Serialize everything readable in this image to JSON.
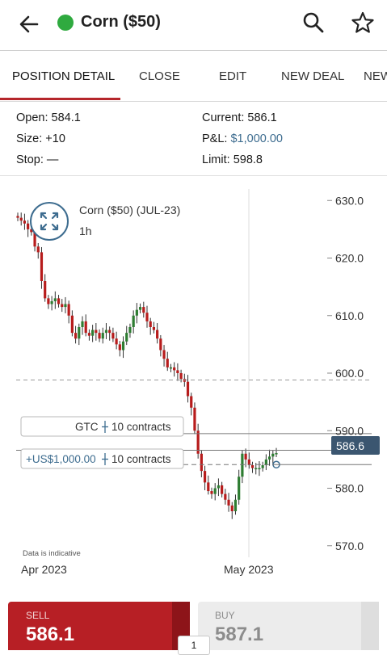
{
  "header": {
    "title": "Corn ($50)",
    "status_color": "#2faa3f",
    "icons": [
      "back-arrow-icon",
      "search-icon",
      "star-icon"
    ]
  },
  "tabs": [
    {
      "label": "POSITION DETAIL",
      "active": true
    },
    {
      "label": "CLOSE",
      "active": false
    },
    {
      "label": "EDIT",
      "active": false
    },
    {
      "label": "NEW DEAL",
      "active": false
    },
    {
      "label": "NEW",
      "active": false
    }
  ],
  "position": {
    "open_label": "Open:",
    "open_value": "584.1",
    "size_label": "Size:",
    "size_value": "+10",
    "stop_label": "Stop:",
    "stop_value": "—",
    "current_label": "Current:",
    "current_value": "586.1",
    "pnl_label": "P&L:",
    "pnl_value": "$1,000.00",
    "limit_label": "Limit:",
    "limit_value": "598.8"
  },
  "chart": {
    "instrument": "Corn ($50) (JUL-23)",
    "interval": "1h",
    "disclaimer": "Data is indicative",
    "current_price_tag": "586.6",
    "order_label_gtc": "GTC",
    "order_label_gtc_contracts": "10 contracts",
    "position_label_pnl": "+US$1,000.00",
    "position_label_contracts": "10 contracts",
    "colors": {
      "up": "#2e7d32",
      "down": "#b71c1c",
      "price_tag": "#3b5670",
      "accent": "#3d6c8f"
    }
  },
  "chart_data": {
    "type": "candlestick",
    "title": "",
    "x_tick_labels": [
      "Apr 2023",
      "May 2023"
    ],
    "y_tick_labels": [
      "630.0",
      "620.0",
      "610.0",
      "600.0",
      "590.0",
      "580.0",
      "570.0"
    ],
    "ylim": [
      568,
      632
    ],
    "grid": false,
    "series": [
      {
        "name": "Corn ($50) (JUL-23)",
        "close": [
          627,
          626.5,
          626,
          625,
          624.5,
          622,
          621,
          616,
          613,
          612,
          612.5,
          613,
          612,
          611.5,
          612,
          610,
          607,
          606,
          608,
          609,
          607,
          606.5,
          607.5,
          607,
          606,
          607,
          607.5,
          607,
          606,
          605,
          604,
          605.5,
          607,
          608,
          610,
          611,
          611.5,
          610.5,
          609,
          608,
          607.5,
          606,
          604,
          602.5,
          601,
          601,
          600.5,
          600,
          599,
          598.5,
          596,
          594,
          590,
          586,
          583,
          581,
          579.5,
          579,
          580,
          580.5,
          579,
          578,
          577,
          576,
          578,
          582,
          586,
          585,
          584,
          583.5,
          583.5,
          583.5,
          584,
          585,
          585.5,
          586,
          586.1
        ]
      }
    ]
  },
  "reference_lines": {
    "limit": 598.8,
    "gtc_order": 589.5,
    "position_open": 584.1,
    "current": 586.6
  },
  "trade": {
    "sell_label": "SELL",
    "sell_price": "586.1",
    "buy_label": "BUY",
    "buy_price": "587.1",
    "quantity": "1",
    "sell_color": "#b71f25"
  }
}
